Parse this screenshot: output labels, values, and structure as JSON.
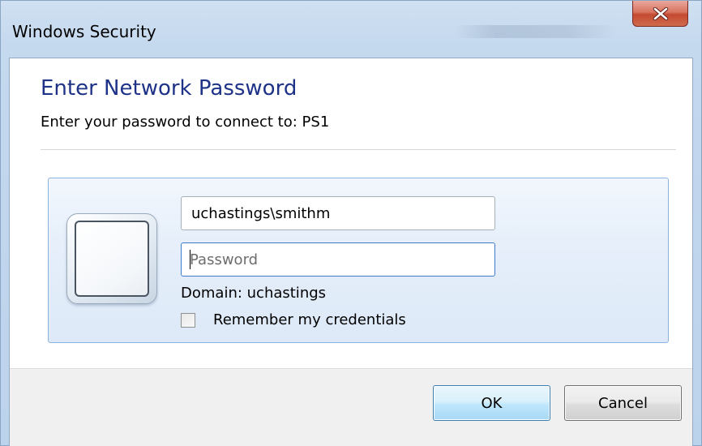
{
  "window": {
    "title": "Windows Security"
  },
  "dialog": {
    "heading": "Enter Network Password",
    "subheading": "Enter your password to connect to: PS1"
  },
  "credentials": {
    "username_value": "uchastings\\smithm",
    "password_placeholder": "Password",
    "password_value": "",
    "domain_text": "Domain: uchastings",
    "remember_label": "Remember my credentials",
    "remember_checked": false
  },
  "buttons": {
    "ok_label": "OK",
    "cancel_label": "Cancel"
  },
  "icons": {
    "close": "close-icon",
    "tile": "user-tile-icon"
  },
  "colors": {
    "heading": "#1e3287",
    "close_button": "#c44a31",
    "focus_border": "#3d7bd0",
    "ok_button": "#bee6fd"
  }
}
